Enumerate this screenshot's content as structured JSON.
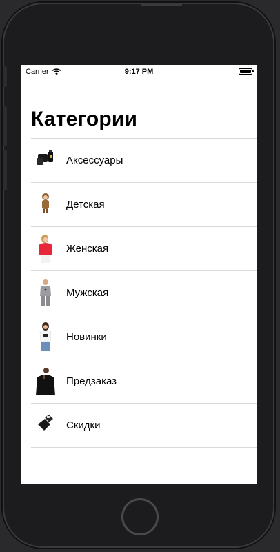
{
  "status_bar": {
    "carrier": "Carrier",
    "time": "9:17 PM",
    "battery_level": 1.0
  },
  "page_title": "Категории",
  "categories": [
    {
      "label": "Аксессуары",
      "thumbnail": "bag-and-bottle-thumbnail"
    },
    {
      "label": "Детская",
      "thumbnail": "kid-costume-thumbnail"
    },
    {
      "label": "Женская",
      "thumbnail": "woman-red-sweater-thumbnail"
    },
    {
      "label": "Мужская",
      "thumbnail": "man-grey-tracksuit-thumbnail"
    },
    {
      "label": "Новинки",
      "thumbnail": "woman-white-tshirt-thumbnail"
    },
    {
      "label": "Предзаказ",
      "thumbnail": "man-black-hoodie-thumbnail"
    },
    {
      "label": "Скидки",
      "thumbnail": "black-gloves-thumbnail"
    }
  ],
  "colors": {
    "screen_background": "#ffffff",
    "separator": "#d9d9dc",
    "device_frame": "#1c1c1e"
  }
}
